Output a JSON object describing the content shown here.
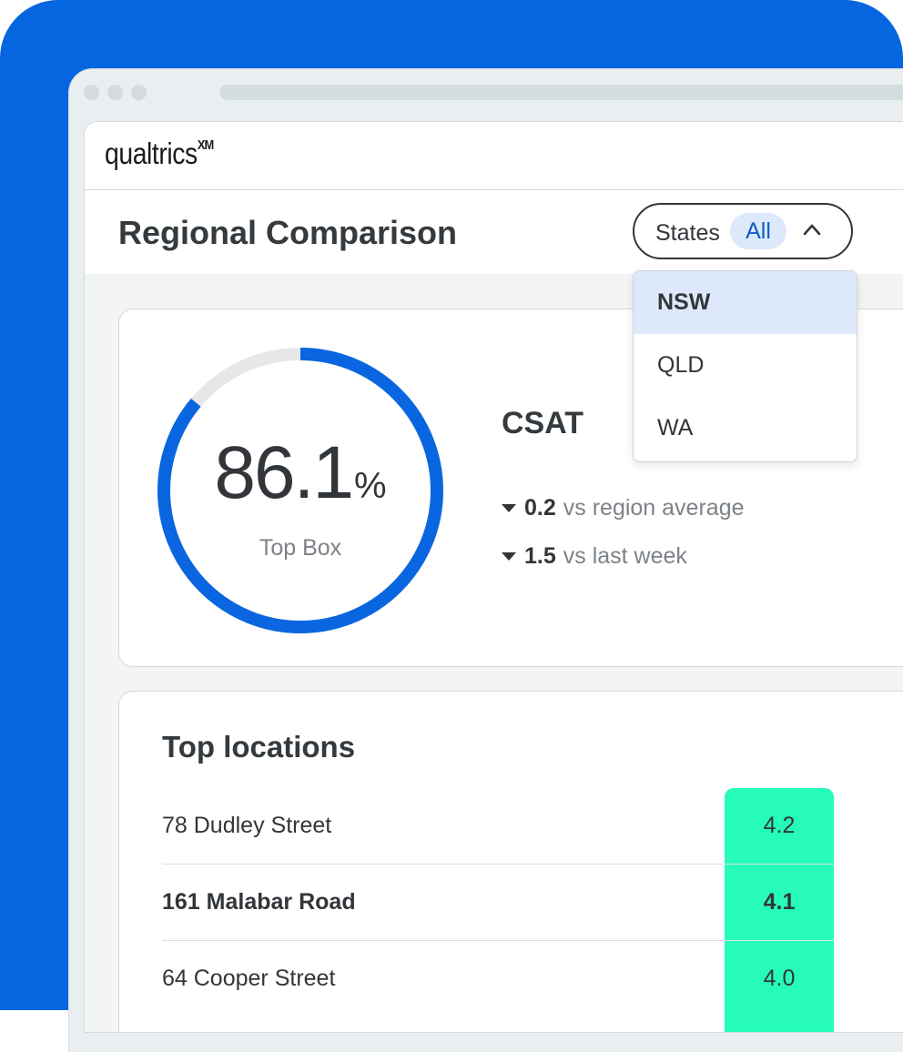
{
  "app": {
    "logo_text": "qualtrics",
    "logo_sup": "XM"
  },
  "header": {
    "title": "Regional Comparison",
    "filter": {
      "label": "States",
      "value": "All"
    }
  },
  "dropdown": {
    "options": [
      {
        "label": "NSW",
        "selected": true
      },
      {
        "label": "QLD",
        "selected": false
      },
      {
        "label": "WA",
        "selected": false
      }
    ]
  },
  "csat": {
    "gauge_value": "86.1",
    "gauge_unit": "%",
    "gauge_fraction": 0.861,
    "gauge_label": "Top Box",
    "title": "CSAT",
    "deltas": [
      {
        "value": "0.2",
        "text": "vs region average"
      },
      {
        "value": "1.5",
        "text": "vs last week"
      }
    ]
  },
  "top_locations": {
    "title": "Top locations",
    "rows": [
      {
        "name": "78 Dudley Street",
        "score": "4.2"
      },
      {
        "name": "161 Malabar Road",
        "score": "4.1"
      },
      {
        "name": "64 Cooper Street",
        "score": "4.0"
      }
    ]
  },
  "colors": {
    "brand_blue": "#0666e0",
    "gauge_fill": "#0a66e0",
    "gauge_track": "#e6e7e8",
    "score_highlight": "#26fbba",
    "selected_option": "#dde9fa"
  }
}
